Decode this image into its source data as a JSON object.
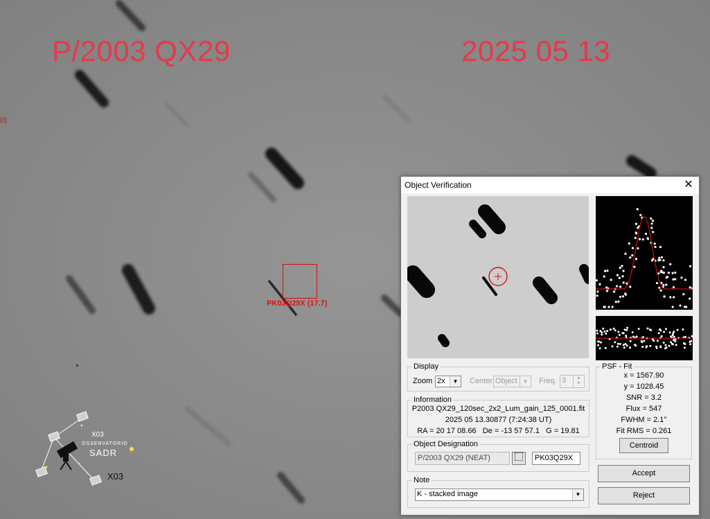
{
  "overlay": {
    "object_title": "P/2003 QX29",
    "date_title": "2025 05 13",
    "target_label": "PK03Q29X (17.7)",
    "edge_label": "0)",
    "accent_color": "#e8384a"
  },
  "logo": {
    "code_top": "X03",
    "org_line": "OSSERVATORIO",
    "name": "SADR",
    "code_bottom": "X03"
  },
  "dialog": {
    "title": "Object Verification",
    "close_icon": "close-icon",
    "display": {
      "legend": "Display",
      "zoom_label": "Zoom",
      "zoom_value": "2x",
      "center_label": "Center",
      "center_value": "Object",
      "freq_label": "Freq.",
      "freq_value": "3"
    },
    "information": {
      "legend": "Information",
      "file": "P2003 QX29_120sec_2x2_Lum_gain_125_0001.fit",
      "time": "2025 05 13.30877 (7:24:38 UT)",
      "coords": "RA = 20 17 08.66   De = -13 57 57.1   G = 19.81"
    },
    "designation": {
      "legend": "Object Designation",
      "name": "P/2003 QX29 (NEAT)",
      "browse_icon": "ellipsis-icon",
      "code": "PK03Q29X"
    },
    "note": {
      "legend": "Note",
      "value": "K - stacked image"
    },
    "psf_fit": {
      "legend": "PSF - Fit",
      "x": "x = 1567.90",
      "y": "y = 1028.45",
      "snr": "SNR = 3.2",
      "flux": "Flux = 547",
      "fwhm": "FWHM = 2.1''",
      "fit_rms": "Fit RMS = 0.261",
      "centroid_label": "Centroid"
    },
    "accept_label": "Accept",
    "reject_label": "Reject"
  }
}
